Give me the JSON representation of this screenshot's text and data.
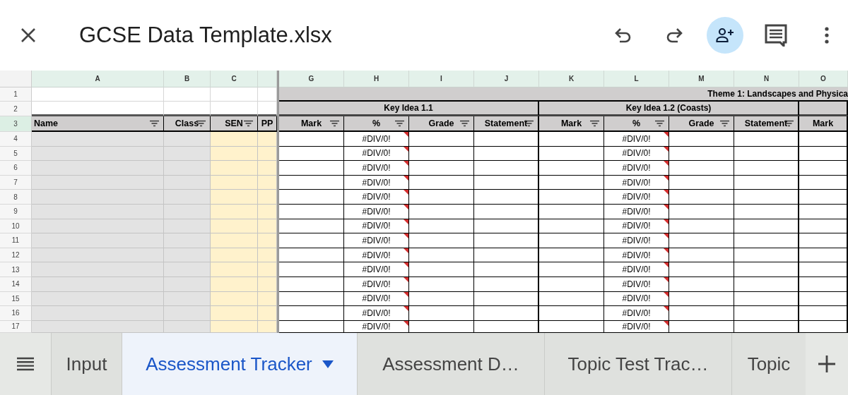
{
  "app_bar": {
    "title": "GCSE Data Template.xlsx"
  },
  "frozen_columns": [
    {
      "letter": "A",
      "header": "Name",
      "kind": "gray",
      "filter": true
    },
    {
      "letter": "B",
      "header": "Class",
      "kind": "gray",
      "filter": true
    },
    {
      "letter": "C",
      "header": "SEN",
      "kind": "yellow",
      "filter": true
    },
    {
      "header": "PP",
      "kind": "yellow",
      "filter": false
    }
  ],
  "theme_title": "Theme 1: Landscapes and Physica",
  "groups": [
    {
      "label": "Key Idea 1.1",
      "columns": [
        {
          "letter": "G",
          "header": "Mark",
          "filter": true
        },
        {
          "letter": "H",
          "header": "%",
          "filter": true,
          "kind": "formula"
        },
        {
          "letter": "I",
          "header": "Grade",
          "filter": true
        },
        {
          "letter": "J",
          "header": "Statement",
          "filter": true
        }
      ]
    },
    {
      "label": "Key Idea 1.2 (Coasts)",
      "columns": [
        {
          "letter": "K",
          "header": "Mark",
          "filter": true
        },
        {
          "letter": "L",
          "header": "%",
          "filter": true,
          "kind": "formula"
        },
        {
          "letter": "M",
          "header": "Grade",
          "filter": true
        },
        {
          "letter": "N",
          "header": "Statement",
          "filter": true
        }
      ]
    },
    {
      "columns": [
        {
          "letter": "O",
          "header": "Mark",
          "filter": false
        }
      ]
    }
  ],
  "header_rows": [
    "1",
    "2",
    "3"
  ],
  "rows": [
    {
      "number": "4",
      "errors": [
        {
          "text": "#DIV/0!",
          "flagged": true
        },
        {
          "text": "#DIV/0!",
          "flagged": true
        }
      ]
    },
    {
      "number": "5",
      "errors": [
        {
          "text": "#DIV/0!",
          "flagged": true
        },
        {
          "text": "#DIV/0!",
          "flagged": true
        }
      ]
    },
    {
      "number": "6",
      "errors": [
        {
          "text": "#DIV/0!",
          "flagged": true
        },
        {
          "text": "#DIV/0!",
          "flagged": true
        }
      ]
    },
    {
      "number": "7",
      "errors": [
        {
          "text": "#DIV/0!",
          "flagged": true
        },
        {
          "text": "#DIV/0!",
          "flagged": true
        }
      ]
    },
    {
      "number": "8",
      "errors": [
        {
          "text": "#DIV/0!",
          "flagged": true
        },
        {
          "text": "#DIV/0!",
          "flagged": true
        }
      ]
    },
    {
      "number": "9",
      "errors": [
        {
          "text": "#DIV/0!",
          "flagged": true
        },
        {
          "text": "#DIV/0!",
          "flagged": true
        }
      ]
    },
    {
      "number": "10",
      "errors": [
        {
          "text": "#DIV/0!",
          "flagged": true
        },
        {
          "text": "#DIV/0!",
          "flagged": true
        }
      ]
    },
    {
      "number": "11",
      "errors": [
        {
          "text": "#DIV/0!",
          "flagged": true
        },
        {
          "text": "#DIV/0!",
          "flagged": true
        }
      ]
    },
    {
      "number": "12",
      "errors": [
        {
          "text": "#DIV/0!",
          "flagged": true
        },
        {
          "text": "#DIV/0!",
          "flagged": true
        }
      ]
    },
    {
      "number": "13",
      "errors": [
        {
          "text": "#DIV/0!",
          "flagged": true
        },
        {
          "text": "#DIV/0!",
          "flagged": true
        }
      ]
    },
    {
      "number": "14",
      "errors": [
        {
          "text": "#DIV/0!",
          "flagged": true
        },
        {
          "text": "#DIV/0!",
          "flagged": true
        }
      ]
    },
    {
      "number": "15",
      "errors": [
        {
          "text": "#DIV/0!",
          "flagged": true
        },
        {
          "text": "#DIV/0!",
          "flagged": true
        }
      ]
    },
    {
      "number": "16",
      "errors": [
        {
          "text": "#DIV/0!",
          "flagged": true
        },
        {
          "text": "#DIV/0!",
          "flagged": true
        }
      ]
    },
    {
      "number": "17",
      "errors": [
        {
          "text": "#DIV/0!",
          "flagged": true
        },
        {
          "text": "#DIV/0!",
          "flagged": true
        }
      ]
    }
  ],
  "sheet_tabs": [
    {
      "label": "Input",
      "selected": false
    },
    {
      "label": "Assessment Tracker",
      "selected": true
    },
    {
      "label": "Assessment D…",
      "selected": false
    },
    {
      "label": "Topic Test Trac…",
      "selected": false
    },
    {
      "label": "Topic",
      "selected": false
    }
  ]
}
